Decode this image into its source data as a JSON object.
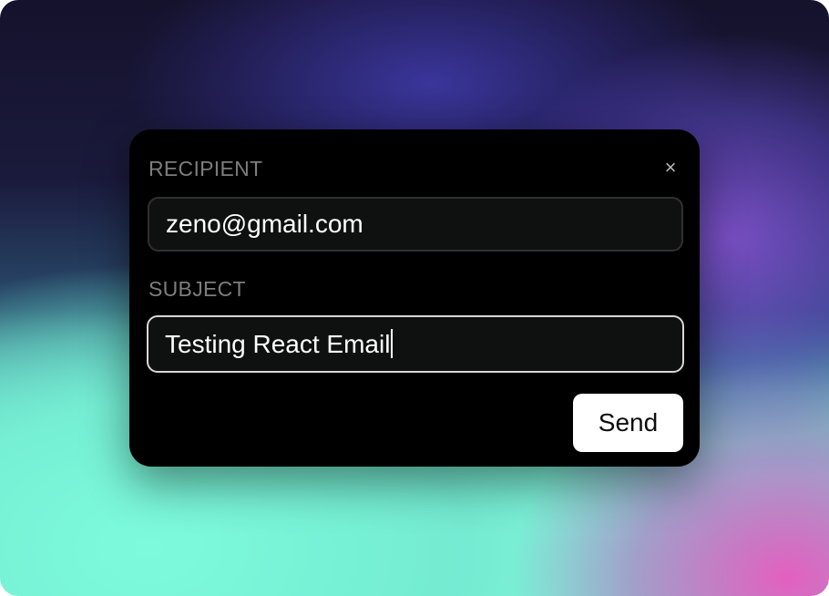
{
  "form": {
    "close_icon": "close-icon",
    "close_glyph": "×",
    "recipient": {
      "label": "RECIPIENT",
      "value": "zeno@gmail.com"
    },
    "subject": {
      "label": "SUBJECT",
      "value": "Testing React Email"
    },
    "send_label": "Send"
  },
  "colors": {
    "dialog_bg": "#000000",
    "field_bg": "#0f1111",
    "label": "#7d7d7d",
    "focus_border": "#d8d8d8",
    "button_bg": "#ffffff"
  }
}
